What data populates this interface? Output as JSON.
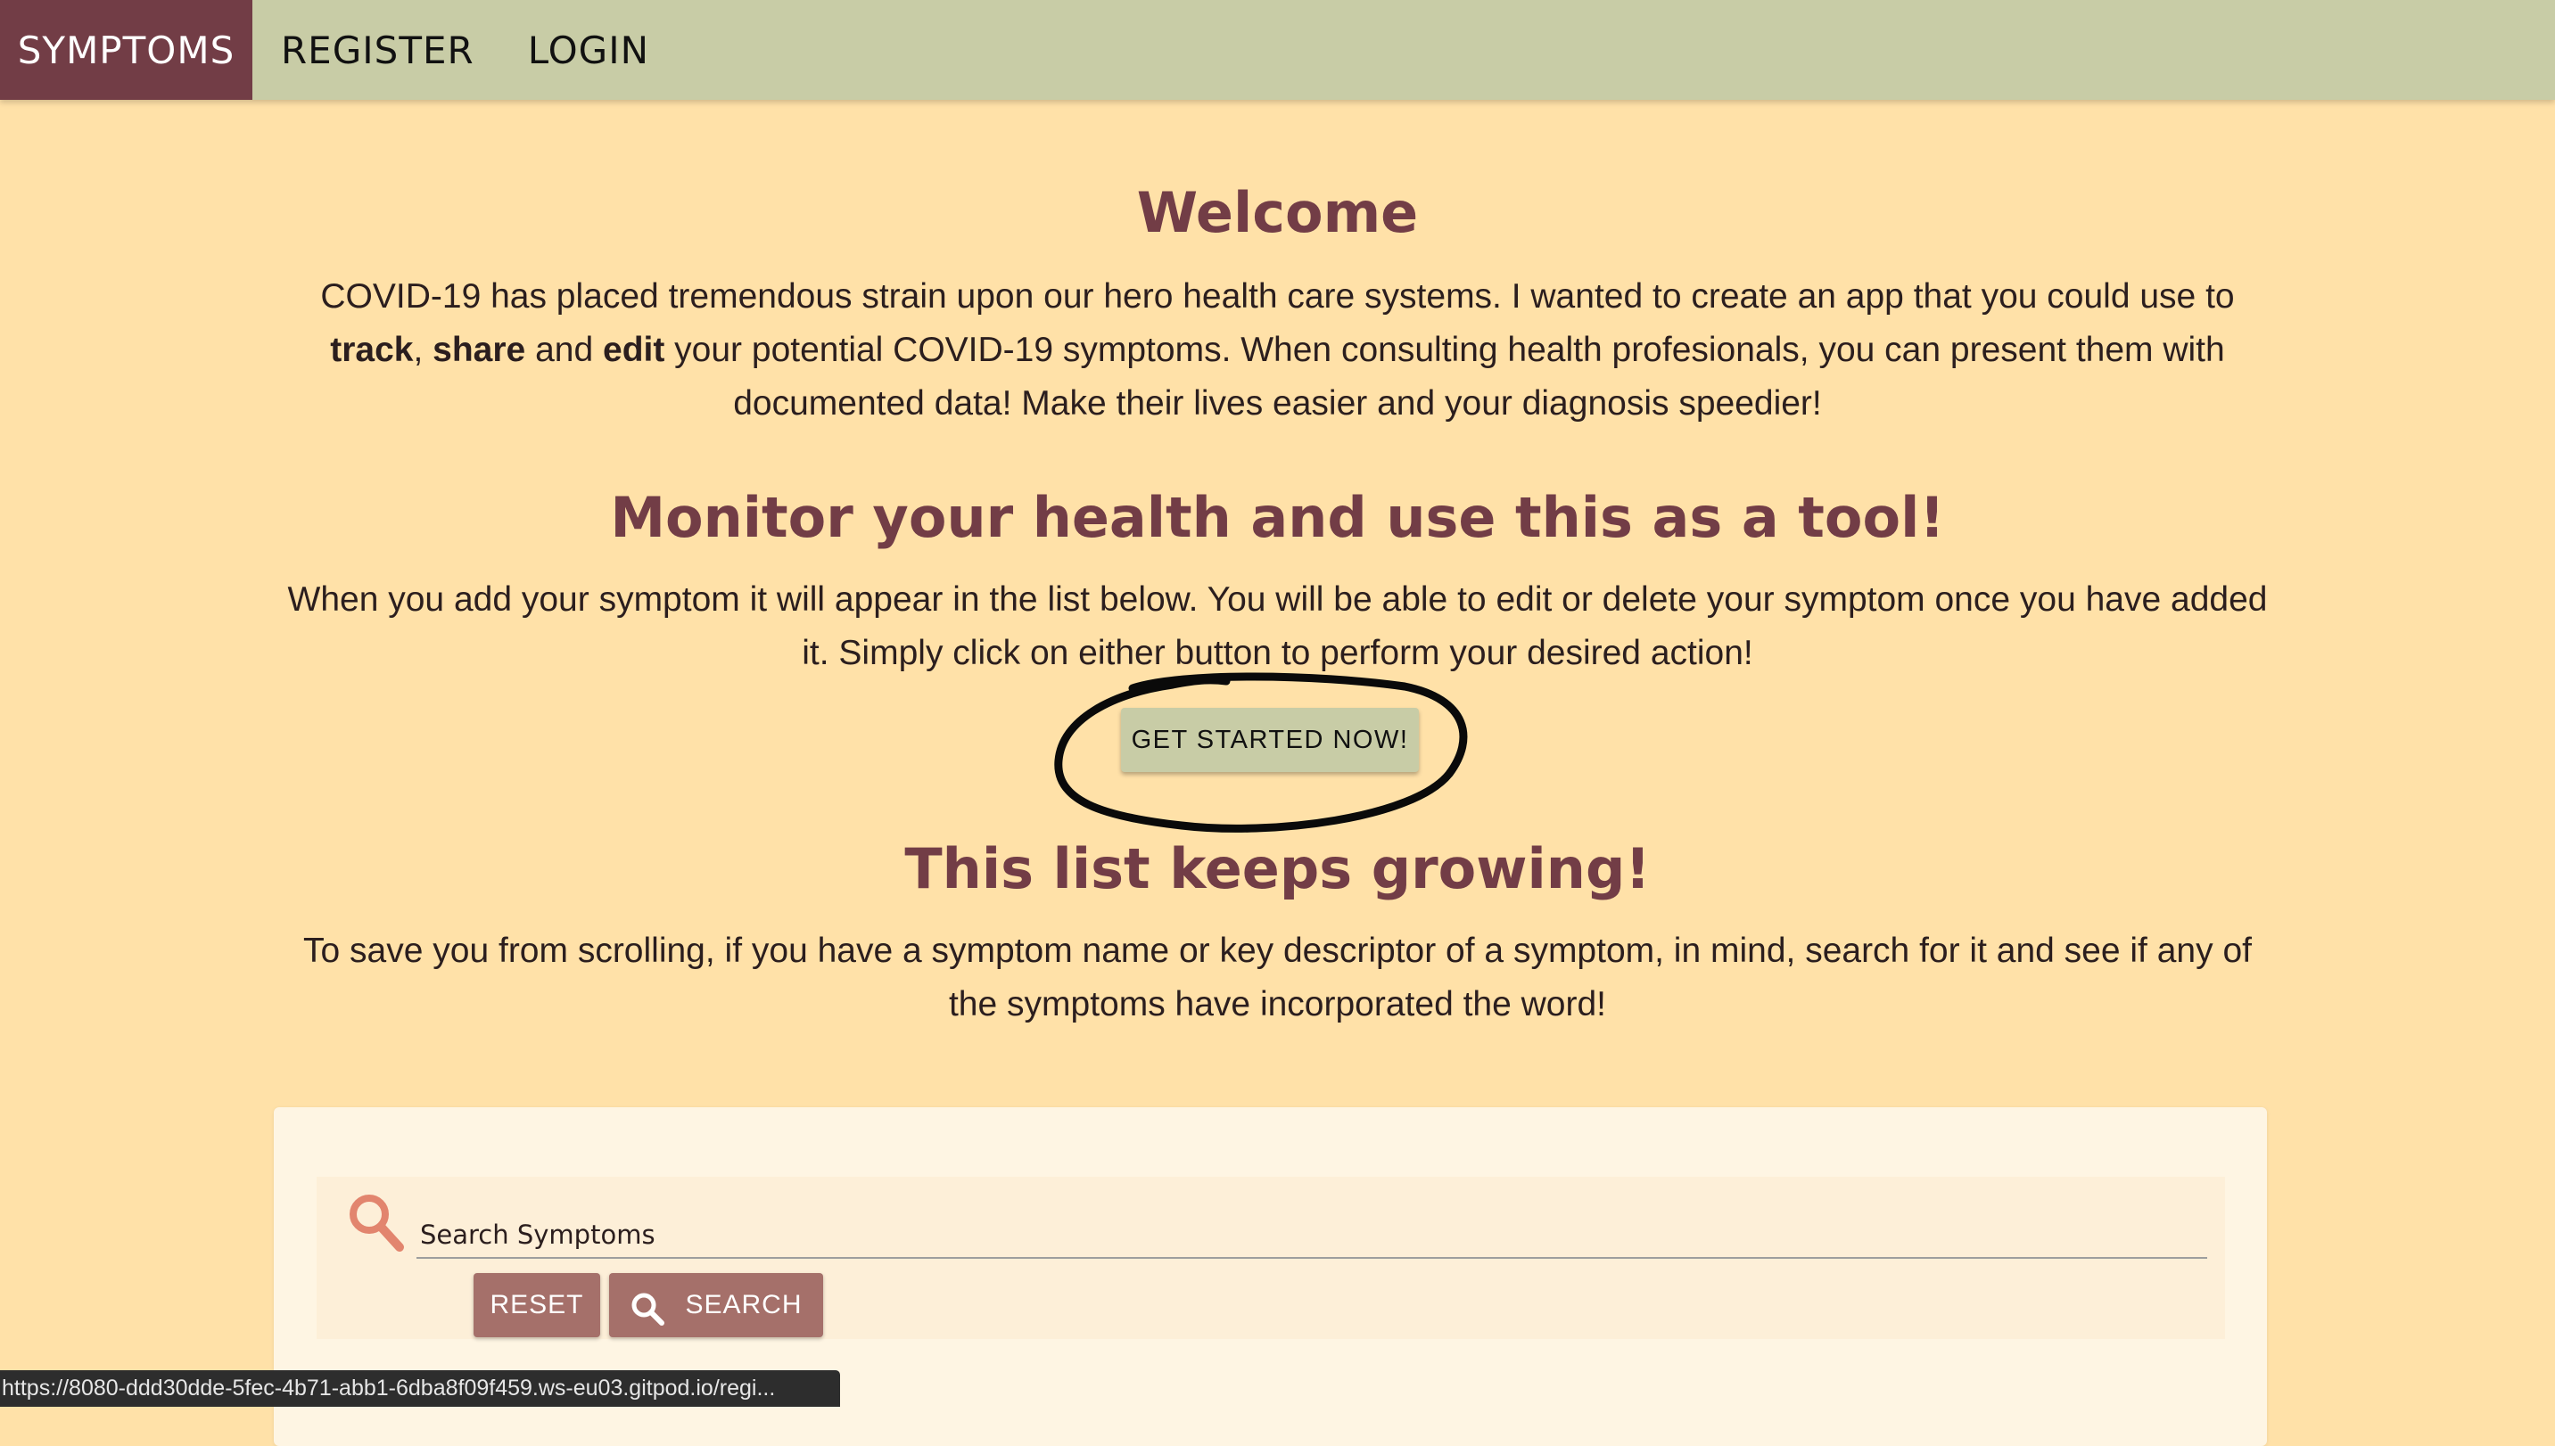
{
  "nav": {
    "brand": "SYMPTOMS",
    "links": [
      "REGISTER",
      "LOGIN"
    ]
  },
  "welcome": {
    "heading": "Welcome",
    "paragraph": {
      "intro": "COVID-19 has placed tremendous strain upon our hero health care systems. I wanted to create an app that you could use to ",
      "track": "track",
      "comma": ", ",
      "share": "share",
      "and": " and ",
      "edit": "edit",
      "outro": " your potential COVID-19 symptoms. When consulting health profesionals, you can present them with documented data! Make their lives easier and your diagnosis speedier!"
    }
  },
  "monitor": {
    "heading": "Monitor your health and use this as a tool!",
    "paragraph": "When you add your symptom it will appear in the list below. You will be able to edit or delete your symptom once you have added it. Simply click on either button to perform your desired action!",
    "cta_label": "GET STARTED NOW!"
  },
  "growing": {
    "heading": "This list keeps growing!",
    "paragraph": "To save you from scrolling, if you have a symptom name or key descriptor of a symptom, in mind, search for it and see if any of the symptoms have incorporated the word!"
  },
  "search": {
    "placeholder": "Search Symptoms",
    "value": "",
    "reset_label": "RESET",
    "search_label": "SEARCH"
  },
  "status_bar": {
    "url": "https://8080-ddd30dde-5fec-4b71-abb1-6dba8f09f459.ws-eu03.gitpod.io/regi..."
  },
  "colors": {
    "background": "#ffe1a8",
    "navbar": "#c8cca6",
    "brand": "#723d46",
    "heading": "#723d46",
    "button": "#a5706a",
    "search_icon": "#e2856e"
  },
  "icons": {
    "search_panel_icon": "magnifier-icon",
    "search_button_icon": "magnifier-icon"
  }
}
